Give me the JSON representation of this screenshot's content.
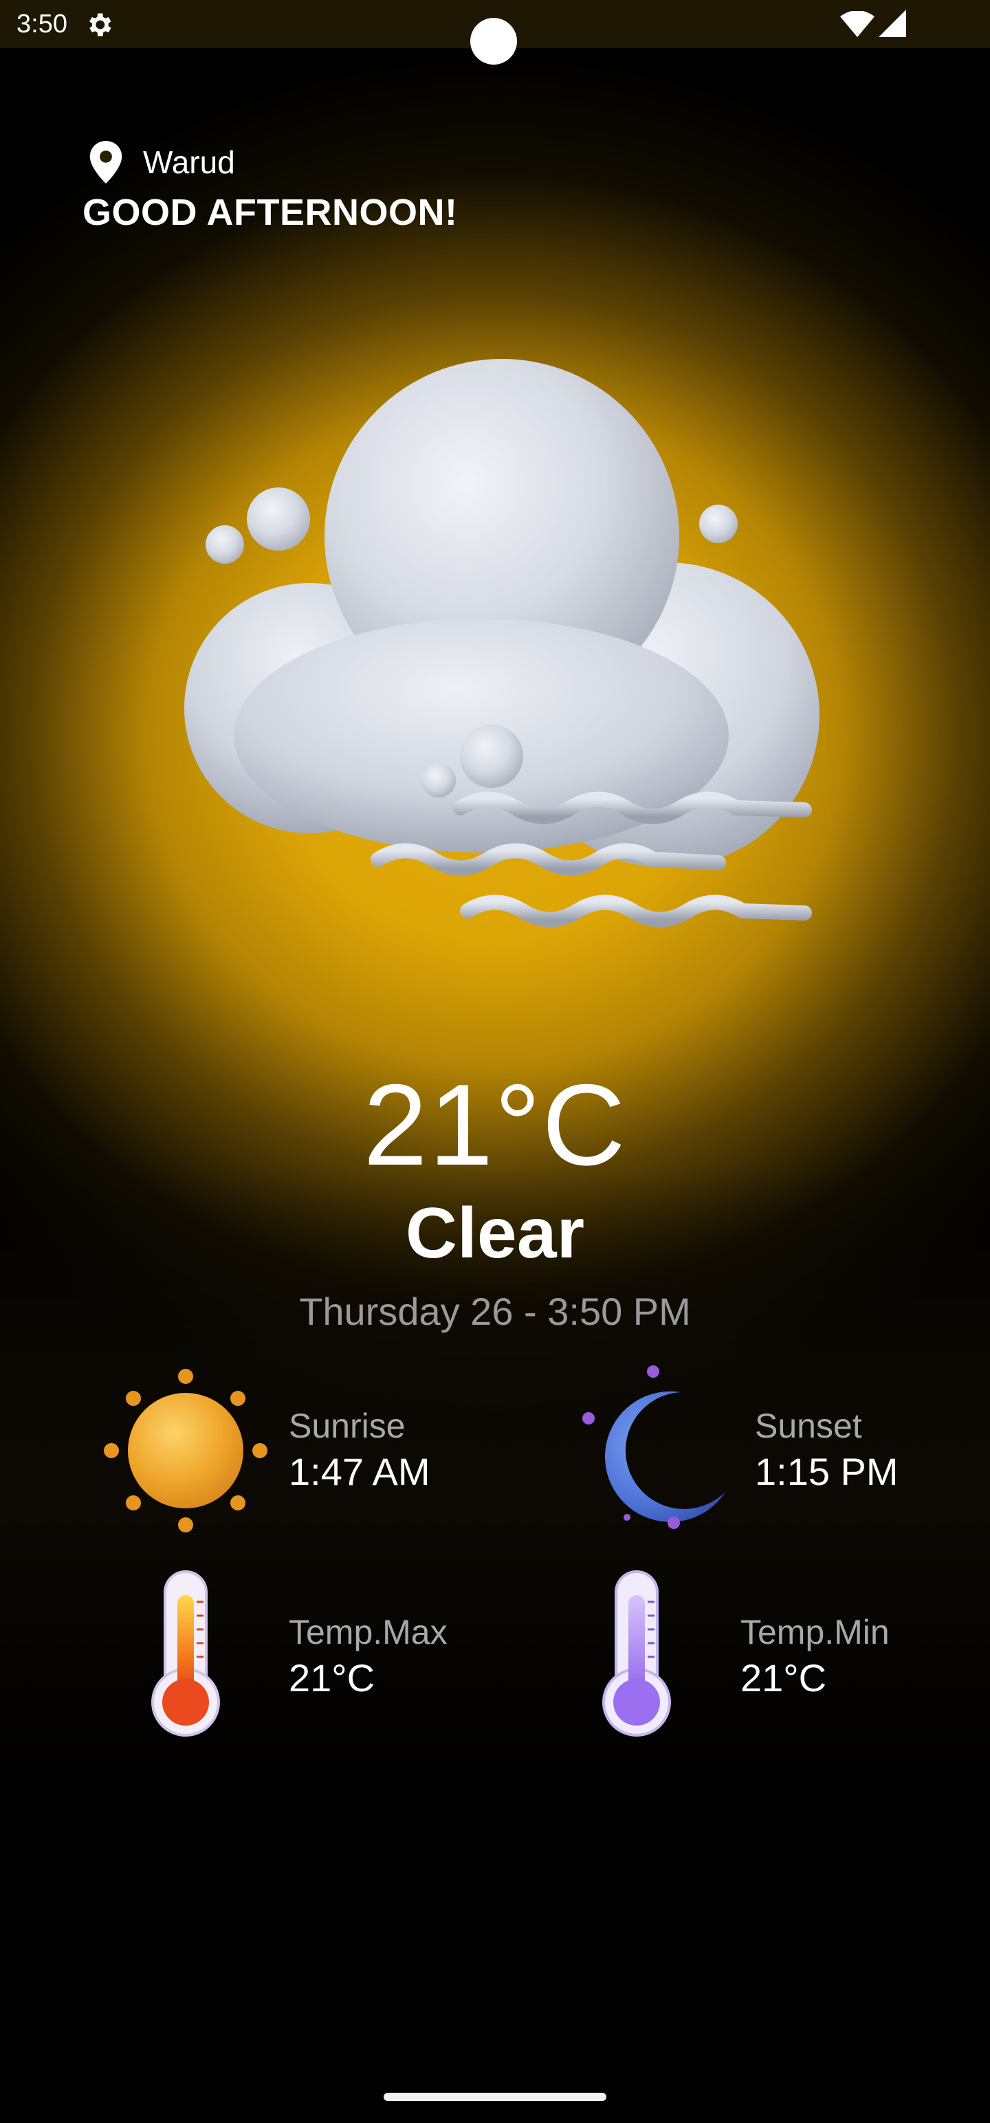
{
  "status_bar": {
    "time": "3:50",
    "icons": [
      "settings-gear-icon",
      "wifi-icon",
      "cell-signal-icon"
    ]
  },
  "header": {
    "location": "Warud",
    "greeting": "GOOD AFTERNOON!"
  },
  "weather": {
    "icon": "cloud-fog-icon",
    "temperature": "21°C",
    "condition": "Clear",
    "datetime": "Thursday 26 - 3:50 PM"
  },
  "details": {
    "sunrise": {
      "label": "Sunrise",
      "value": "1:47 AM",
      "icon": "sun-icon"
    },
    "sunset": {
      "label": "Sunset",
      "value": "1:15 PM",
      "icon": "moon-icon"
    },
    "temp_max": {
      "label": "Temp.Max",
      "value": "21°C",
      "icon": "thermometer-hot-icon"
    },
    "temp_min": {
      "label": "Temp.Min",
      "value": "21°C",
      "icon": "thermometer-cold-icon"
    }
  },
  "colors": {
    "accent_yellow": "#E2AA08",
    "background": "#000000",
    "secondary_text": "#A8A8A8"
  }
}
